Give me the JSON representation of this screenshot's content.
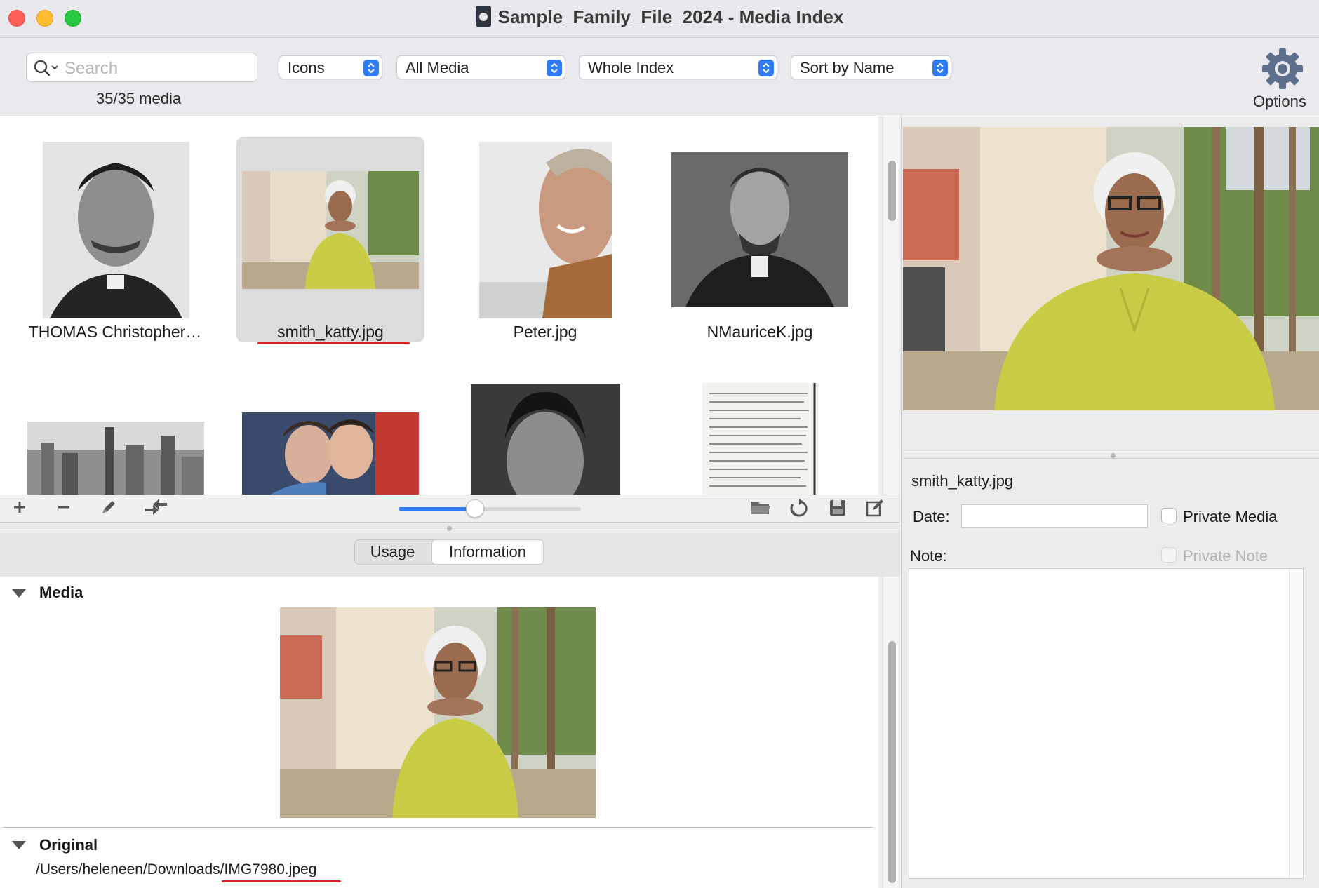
{
  "window": {
    "title": "Sample_Family_File_2024 - Media Index"
  },
  "toolbar": {
    "search_placeholder": "Search",
    "media_count": "35/35 media",
    "view_mode": "Icons",
    "media_filter": "All Media",
    "scope": "Whole Index",
    "sort": "Sort by Name",
    "options_label": "Options"
  },
  "grid": {
    "items": [
      {
        "label": "THOMAS Christopher…",
        "selected": false
      },
      {
        "label": "smith_katty.jpg",
        "selected": true
      },
      {
        "label": "Peter.jpg",
        "selected": false
      },
      {
        "label": "NMauriceK.jpg",
        "selected": false
      }
    ],
    "thumbnail_size": 0.42
  },
  "tabs": {
    "usage": "Usage",
    "information": "Information",
    "active": "Information"
  },
  "info": {
    "media_section": "Media",
    "original_section": "Original",
    "original_path": "/Users/heleneen/Downloads/IMG7980.jpeg"
  },
  "detail": {
    "filename": "smith_katty.jpg",
    "date_label": "Date:",
    "date_value": "",
    "private_media_label": "Private Media",
    "note_label": "Note:",
    "private_note_label": "Private Note"
  },
  "colors": {
    "accent": "#2f7cf6",
    "annotation_red": "#d8232a"
  }
}
